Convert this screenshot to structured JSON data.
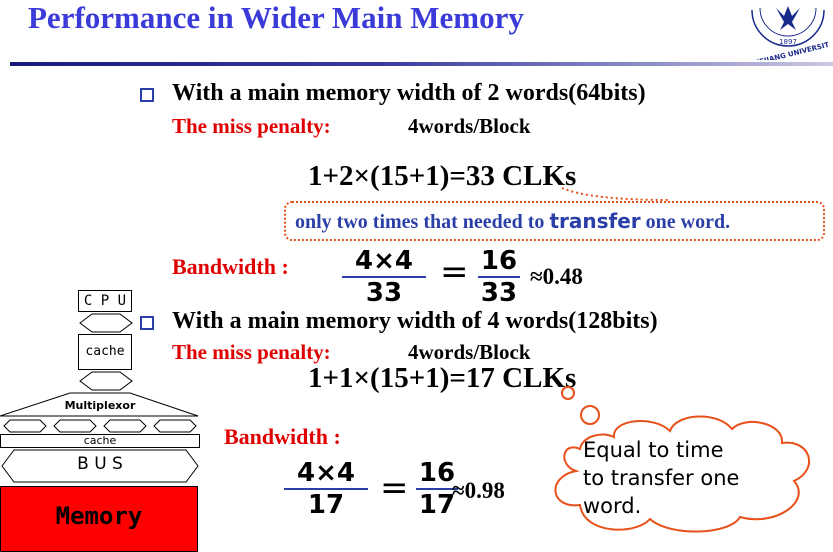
{
  "slide": {
    "title": "Performance in Wider Main Memory",
    "logo_text": "ZHEJIANG UNIVERSITY",
    "logo_year": "1897"
  },
  "section1": {
    "heading": "With a main memory width of 2 words(64bits)",
    "miss_penalty_label": "The miss penalty:",
    "miss_penalty_value": "4words/Block",
    "formula": "1+2×(15+1)=33 CLKs",
    "note_part1": "only two times that needed to ",
    "note_highlight": "transfer",
    "note_part2": " one word.",
    "bandwidth_label": "Bandwidth :",
    "frac1_num": "4×4",
    "frac1_den": "33",
    "equals": "=",
    "frac2_num": "16",
    "frac2_den": "33",
    "result": "≈0.48"
  },
  "section2": {
    "heading": "With a main memory width of 4 words(128bits)",
    "miss_penalty_label": "The miss penalty:",
    "miss_penalty_value": "4words/Block",
    "formula": "1+1×(15+1)=17 CLKs",
    "bandwidth_label": "Bandwidth :",
    "frac1_num": "4×4",
    "frac1_den": "17",
    "equals": "=",
    "frac2_num": "16",
    "frac2_den": "17",
    "result": "≈0.98",
    "cloud_line1": "Equal to time",
    "cloud_line2": "to transfer one",
    "cloud_line3": "word."
  },
  "diagram": {
    "cpu": "C P U",
    "cache_top": "cache",
    "multiplexor": "Multiplexor",
    "cache_bottom": "cache",
    "bus": "B U S",
    "memory": "Memory"
  },
  "colors": {
    "title": "#3b3bd9",
    "red": "#e00000",
    "note_blue": "#2a3fa8",
    "dotted_border": "#e8501a",
    "memory": "#ff0000"
  }
}
